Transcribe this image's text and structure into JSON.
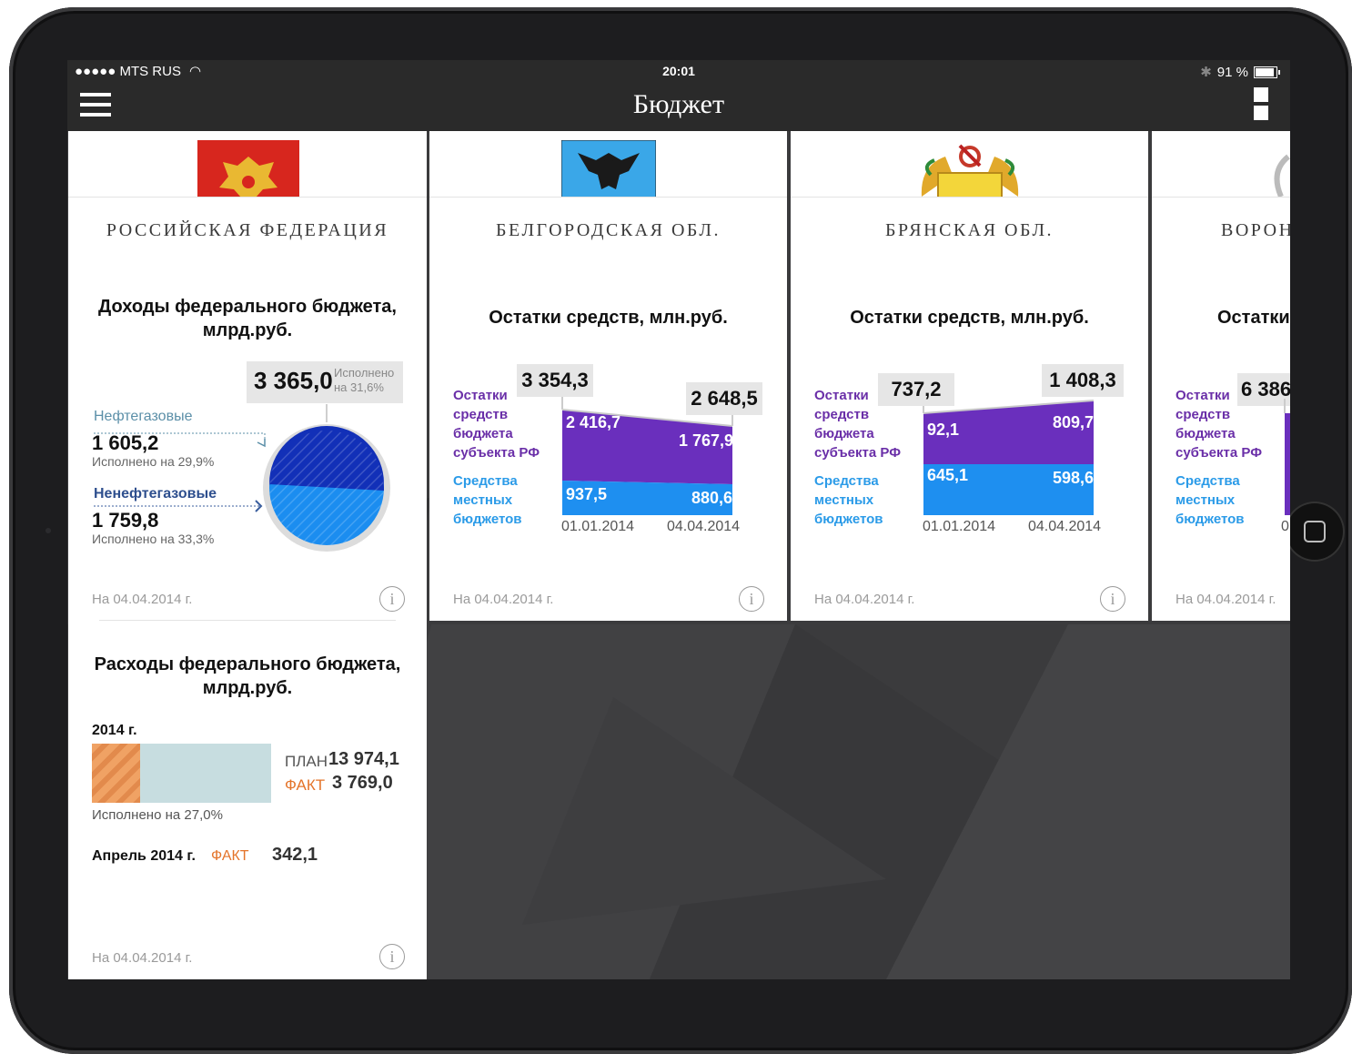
{
  "status": {
    "carrier": "●●●●● MTS RUS",
    "time": "20:01",
    "battery": "91 %"
  },
  "nav": {
    "title": "Бюджет"
  },
  "date_note": "На 04.04.2014 г.",
  "cards": {
    "rf": {
      "region": "РОССИЙСКАЯ ФЕДЕРАЦИЯ",
      "income_title_1": "Доходы федерального бюджета,",
      "income_title_2": "млрд.руб.",
      "total_value": "3 365,0",
      "total_note_1": "Исполнено",
      "total_note_2": "на 31,6%",
      "oil_label": "Нефтегазовые",
      "oil_value": "1 605,2",
      "oil_note": "Исполнено на 29,9%",
      "nonoil_label": "Ненефтегазовые",
      "nonoil_value": "1 759,8",
      "nonoil_note": "Исполнено на 33,3%",
      "exp_title_1": "Расходы федерального бюджета,",
      "exp_title_2": "млрд.руб.",
      "year": "2014 г.",
      "plan_label": "ПЛАН",
      "plan_value": "13 974,1",
      "fact_label": "ФАКТ",
      "fact_value": "3 769,0",
      "exp_note": "Исполнено на 27,0%",
      "april_label": "Апрель 2014 г.",
      "april_fact_label": "ФАКТ",
      "april_value": "342,1",
      "progress_fraction": 0.27
    },
    "belgorod": {
      "region": "БЕЛГОРОДСКАЯ ОБЛ.",
      "title": "Остатки средств, млн.руб.",
      "total_start": "3 354,3",
      "total_end": "2 648,5",
      "subj_start": "2 416,7",
      "subj_end": "1 767,9",
      "local_start": "937,5",
      "local_end": "880,6",
      "date_start": "01.01.2014",
      "date_end": "04.04.2014"
    },
    "bryansk": {
      "region": "БРЯНСКАЯ ОБЛ.",
      "title": "Остатки средств, млн.руб.",
      "total_start": "737,2",
      "total_end": "1 408,3",
      "subj_start": "92,1",
      "subj_end": "809,7",
      "local_start": "645,1",
      "local_end": "598,6",
      "date_start": "01.01.2014",
      "date_end": "04.04.2014"
    },
    "voronezh": {
      "region": "ВОРОН",
      "title": "Остатки",
      "total_start": "6 386,",
      "date_start": "0"
    }
  },
  "legend": {
    "subj": [
      "Остатки",
      "средств",
      "бюджета",
      "субъекта РФ"
    ],
    "local": [
      "Средства",
      "местных",
      "бюджетов"
    ]
  },
  "colors": {
    "purple": "#6a2fbd",
    "blue": "#1e8ff0",
    "fact": "#e4742a",
    "oil": "#5b8fa8"
  }
}
